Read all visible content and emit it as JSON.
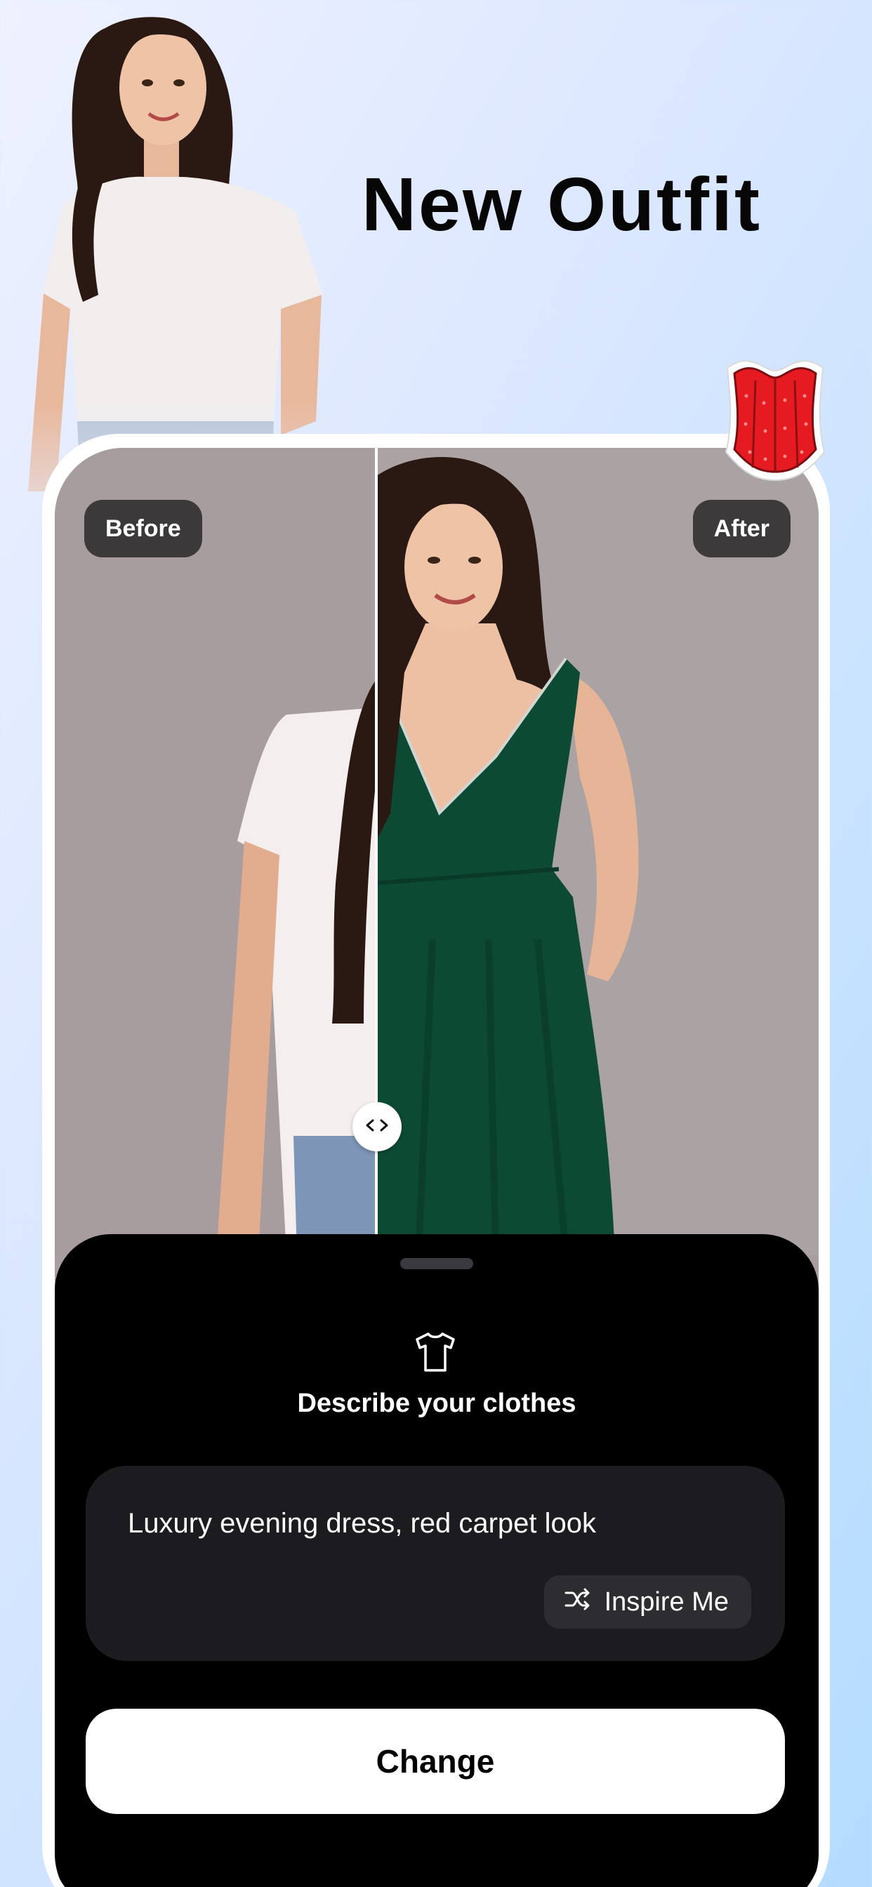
{
  "hero": {
    "title": "New Outfit"
  },
  "compare": {
    "before_label": "Before",
    "after_label": "After",
    "slider_position": 0.42
  },
  "sheet": {
    "title": "Describe your clothes",
    "prompt_value": "Luxury evening dress, red carpet look",
    "inspire_label": "Inspire Me",
    "change_label": "Change"
  },
  "icons": {
    "shirt": "shirt-icon",
    "shuffle": "shuffle-icon",
    "slider": "chevrons-left-right-icon",
    "corset": "corset-sticker"
  },
  "colors": {
    "accent_dress": "#0d4a34",
    "sheet_bg": "#000000",
    "prompt_bg": "#1c1c20",
    "button_bg": "#ffffff",
    "corset": "#e61b22"
  }
}
